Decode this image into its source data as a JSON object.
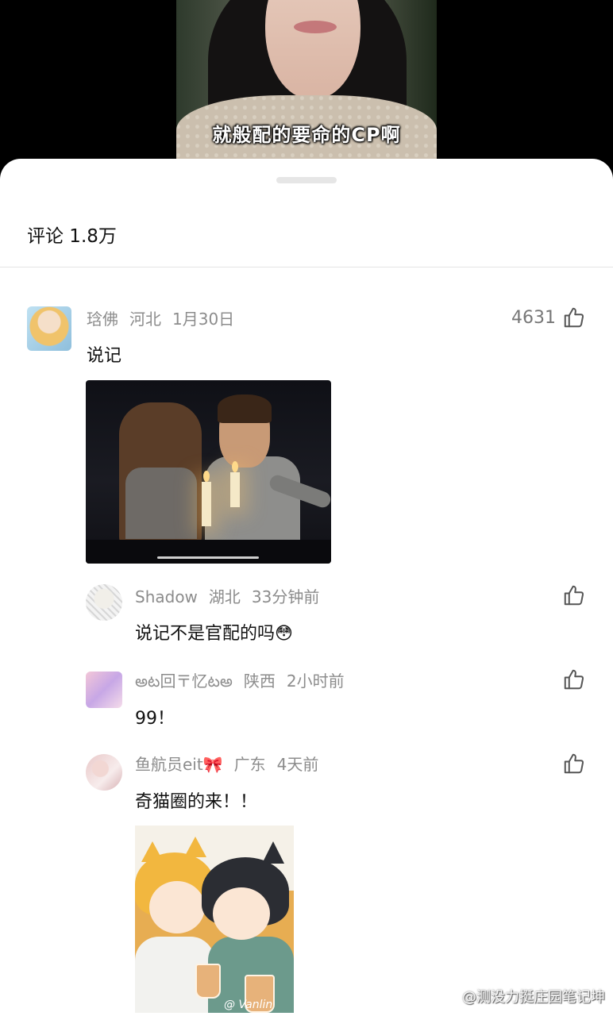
{
  "video": {
    "subtitle": "就般配的要命的CP啊"
  },
  "comments": {
    "title": "评论 1.8万",
    "main": {
      "username": "琀佛",
      "location": "河北",
      "time": "1月30日",
      "likes": "4631",
      "text": "说记"
    },
    "replies": [
      {
        "username": "Shadow",
        "location": "湖北",
        "time": "33分钟前",
        "text": "说记不是官配的吗😳"
      },
      {
        "username": "అట回〒忆టఅ",
        "location": "陕西",
        "time": "2小时前",
        "text": "99！"
      },
      {
        "username": "鱼航员eit🎀",
        "location": "广东",
        "time": "4天前",
        "text": "奇猫圈的来！！",
        "image_signature": "@ Vanlin"
      }
    ]
  },
  "watermark": "@测没力挺庄园笔记坤",
  "colors": {
    "meta_text": "#8c8c8c",
    "body_text": "#111111",
    "sheet_bg": "#ffffff"
  },
  "icons": {
    "like": "thumbs-up-icon"
  }
}
